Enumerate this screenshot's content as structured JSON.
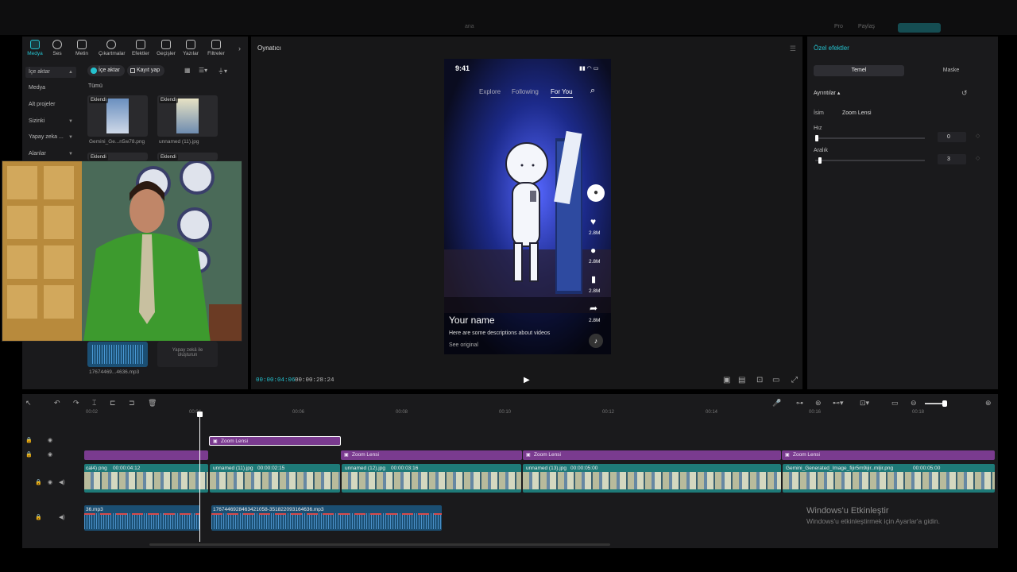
{
  "topbar": {
    "title": "ana",
    "badge": "Pro",
    "badge2": "Paylaş"
  },
  "media_toolbar": [
    {
      "label": "Medya"
    },
    {
      "label": "Ses"
    },
    {
      "label": "Metin"
    },
    {
      "label": "Çıkartmalar"
    },
    {
      "label": "Efektler"
    },
    {
      "label": "Geçişler"
    },
    {
      "label": "Yazılar"
    },
    {
      "label": "Filtreler"
    }
  ],
  "media_side": {
    "import": "İçe aktar",
    "media": "Medya",
    "subprojects": "Alt projeler",
    "yours": "Sizinki",
    "ai": "Yapay zeka ...",
    "areas": "Alanlar"
  },
  "media_actions": {
    "import": "İçe aktar",
    "record": "Kayıt yap"
  },
  "media_filter": "Tümü",
  "media_items": [
    {
      "tag": "Eklendi",
      "name": "Gemini_Ge...n5w78.png"
    },
    {
      "tag": "Eklendi",
      "name": "unnamed (11).jpg"
    },
    {
      "tag": "Eklendi",
      "name": ""
    },
    {
      "tag": "Eklendi",
      "name": ""
    }
  ],
  "media_audio": {
    "name": "17674469...4636.mp3",
    "ai_label": "Yapay zekâ ile oluşturun"
  },
  "player": {
    "title": "Oynatıcı",
    "current_time": "00:00:04:06",
    "total_time": "00:00:28:24"
  },
  "phone": {
    "time": "9:41",
    "tabs": [
      "Explore",
      "Following",
      "For You"
    ],
    "counts": [
      "2.8M",
      "2.8M",
      "2.8M",
      "2.8M"
    ],
    "username": "Your name",
    "description": "Here are some descriptions about videos",
    "see_original": "See original"
  },
  "props": {
    "title": "Özel efektler",
    "tabs": [
      "Temel",
      "Maske"
    ],
    "section": "Ayrıntılar",
    "name_label": "İsim",
    "name_value": "Zoom Lensi",
    "speed_label": "Hız",
    "speed_value": "0",
    "speed_fraction": 0,
    "spacing_label": "Aralık",
    "spacing_value": "3",
    "spacing_fraction": 0.03
  },
  "timeline": {
    "ticks": [
      "00:02",
      "00:04",
      "00:06",
      "00:08",
      "00:10",
      "00:12",
      "00:14",
      "00:16",
      "00:18"
    ],
    "fx_top": "Zoom Lensi",
    "fx_row": [
      "Zoom Lensi",
      "Zoom Lensi",
      "Zoom Lensi"
    ],
    "video_clips": [
      {
        "name": "cal4) png",
        "dur": "00:00:04:12"
      },
      {
        "name": "unnamed (11).jpg",
        "dur": "00:00:02:15"
      },
      {
        "name": "unnamed (12).jpg",
        "dur": "00:00:03:16"
      },
      {
        "name": "unnamed (13).jpg",
        "dur": "00:00:05:00"
      },
      {
        "name": "Gemini_Generated_Image_fijir5m9ijir..mljir.png",
        "dur": "00:00:05:00"
      }
    ],
    "audio_clips": [
      {
        "name": "36.mp3"
      },
      {
        "name": "1767446928463421058-351822093164636.mp3"
      }
    ]
  },
  "watermark": {
    "title": "Windows'u Etkinleştir",
    "subtitle": "Windows'u etkinleştirmek için Ayarlar'a gidin."
  }
}
